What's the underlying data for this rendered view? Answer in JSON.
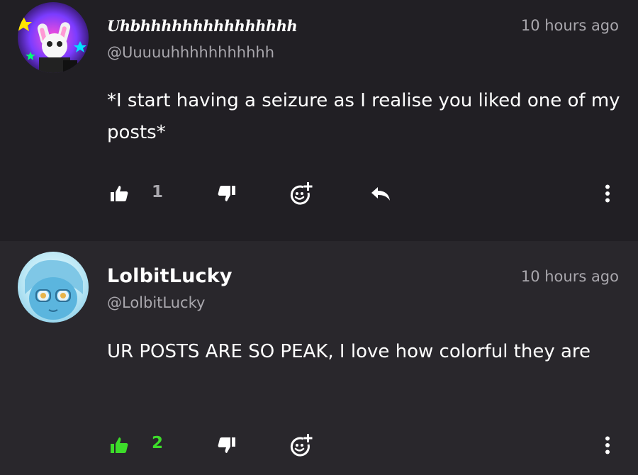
{
  "comments": [
    {
      "display_name": "Uhbhhhhhhhhhhhhhhh",
      "handle": "@Uuuuuhhhhhhhhhhh",
      "timestamp": "10 hours ago",
      "body": "*I start having a seizure as I realise you liked one of my posts*",
      "like_count": "1",
      "liked": false,
      "has_reply_button": true,
      "icons": [
        "avatar",
        "thumbs-up-icon",
        "thumbs-down-icon",
        "add-reaction-icon",
        "reply-icon",
        "more-vertical-icon"
      ]
    },
    {
      "display_name": "LolbitLucky",
      "handle": "@LolbitLucky",
      "timestamp": "10 hours ago",
      "body": "UR POSTS ARE SO PEAK, I love how colorful they are",
      "like_count": "2",
      "liked": true,
      "has_reply_button": false,
      "icons": [
        "avatar",
        "thumbs-up-icon",
        "thumbs-down-icon",
        "add-reaction-icon",
        "more-vertical-icon"
      ]
    }
  ],
  "colors": {
    "background": "#211f24",
    "background_alt": "#29272c",
    "text_primary": "#ffffff",
    "text_secondary": "#a9a7ad",
    "liked_green": "#3ddc2a"
  }
}
